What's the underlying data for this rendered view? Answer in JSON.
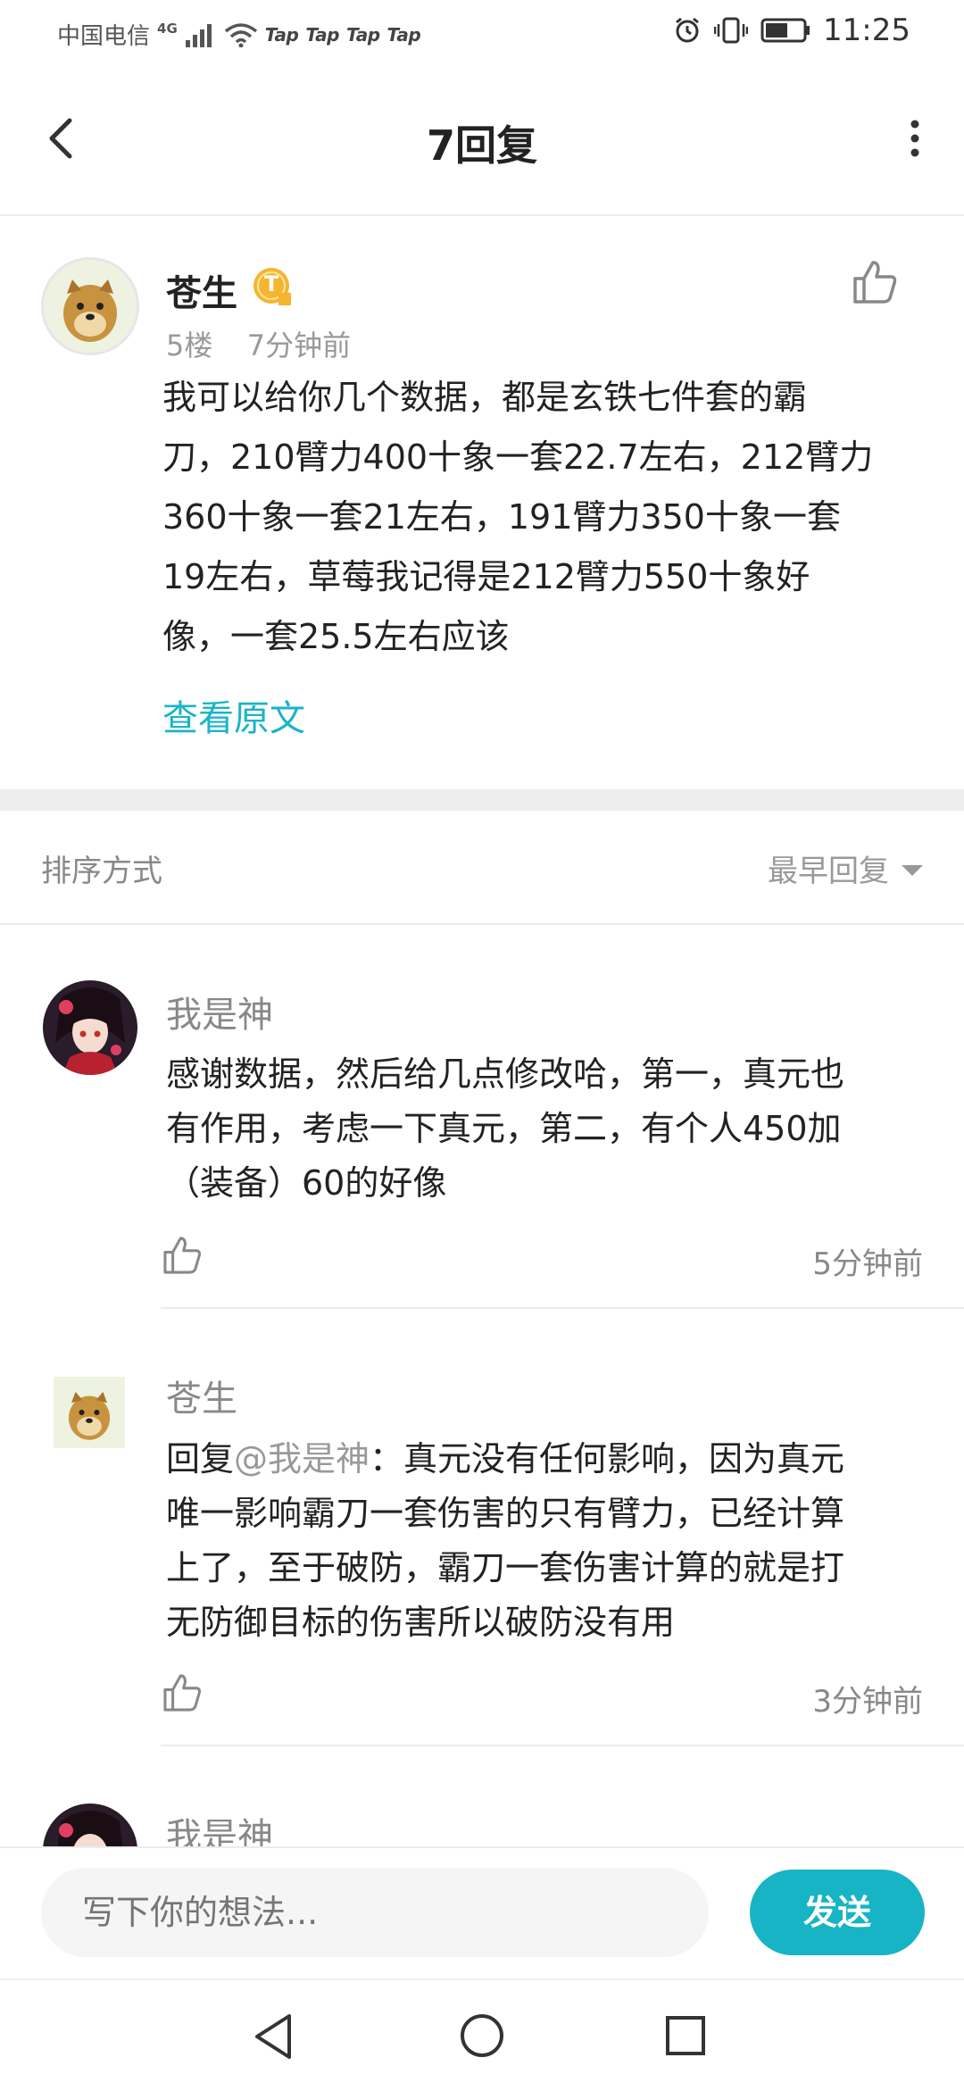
{
  "status_bar": {
    "carrier": "中国电信",
    "network": "4G",
    "tap_labels": [
      "Tap",
      "Tap",
      "Tap",
      "Tap"
    ],
    "time": "11:25",
    "icons": [
      "signal-icon",
      "wifi-icon",
      "alarm-icon",
      "vibrate-icon",
      "battery-icon"
    ]
  },
  "header": {
    "title": "7回复",
    "icons": [
      "back-arrow-icon",
      "more-dots-icon"
    ]
  },
  "main_post": {
    "author": "苍生",
    "badge_icon": "t-badge-icon",
    "badge_text": "T",
    "floor": "5楼",
    "time": "7分钟前",
    "content_lines": [
      "我可以给你几个数据，都是玄铁七件套的霸",
      "刀，210臂力400十象一套22.7左右，212臂力",
      "360十象一套21左右，191臂力350十象一套",
      "19左右，草莓我记得是212臂力550十象好",
      "像，一套25.5左右应该"
    ],
    "view_original": "查看原文",
    "like_icon": "thumbs-up-icon"
  },
  "sort": {
    "label": "排序方式",
    "selected": "最早回复"
  },
  "replies": [
    {
      "author": "我是神",
      "content_lines": [
        "感谢数据，然后给几点修改哈，第一，真元也",
        "有作用，考虑一下真元，第二，有个人450加",
        "（装备）60的好像"
      ],
      "time": "5分钟前"
    },
    {
      "author": "苍生",
      "reply_prefix": "回复",
      "mention": "@我是神",
      "content_first": "：真元没有任何影响，因为真元",
      "content_lines": [
        "唯一影响霸刀一套伤害的只有臂力，已经计算",
        "上了，至于破防，霸刀一套伤害计算的就是打",
        "无防御目标的伤害所以破防没有用"
      ],
      "time": "3分钟前"
    },
    {
      "author": "我是神"
    }
  ],
  "input_bar": {
    "placeholder": "写下你的想法...",
    "send_label": "发送"
  },
  "nav_bar": {
    "icons": [
      "nav-back-icon",
      "nav-home-icon",
      "nav-recents-icon"
    ]
  },
  "colors": {
    "accent": "#17b4c6",
    "link": "#1ab4c8",
    "badge": "#f5b52e"
  }
}
